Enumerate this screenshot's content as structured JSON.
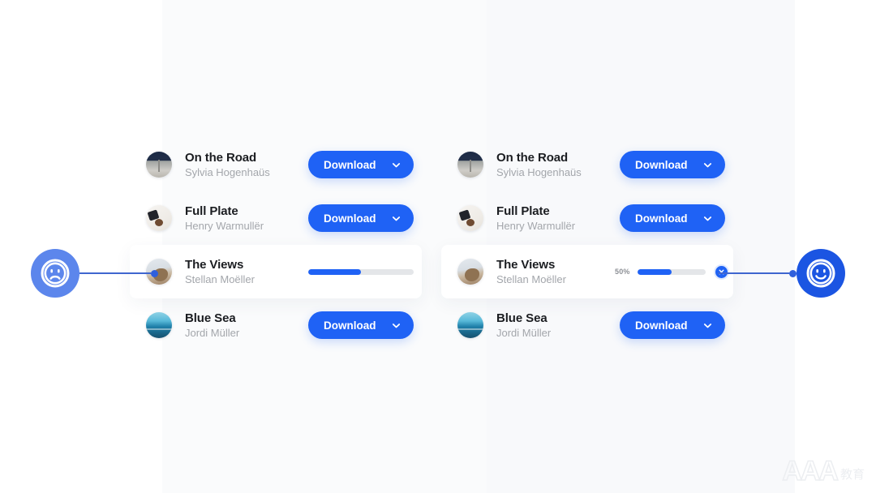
{
  "theme": {
    "accent": "#1f62f5",
    "accent_dark": "#1b55e2",
    "accent_soft": "#5c86ec",
    "page_bg": "#ffffff",
    "panel_bg": "#fafbfc",
    "card_bg": "#ffffff",
    "title_color": "#1b1d21",
    "subtitle_color": "#a3a6ab",
    "track_color": "#e4e6e9"
  },
  "variants": [
    {
      "id": "before",
      "state_icon": "sad-face-icon",
      "items": [
        {
          "title": "On the Road",
          "artist": "Sylvia Hogenhaüs",
          "avatar": "av-road",
          "action": "download",
          "button_label": "Download",
          "chevron": "chevron-down-icon"
        },
        {
          "title": "Full Plate",
          "artist": "Henry Warmullër",
          "avatar": "av-plate",
          "action": "download",
          "button_label": "Download",
          "chevron": "chevron-down-icon"
        },
        {
          "title": "The Views",
          "artist": "Stellan Moëller",
          "avatar": "av-views",
          "action": "progress",
          "progress_percent": 50,
          "percent_label": "",
          "show_percent": false,
          "show_cancel": false
        },
        {
          "title": "Blue Sea",
          "artist": "Jordi Müller",
          "avatar": "av-sea",
          "action": "download",
          "button_label": "Download",
          "chevron": "chevron-down-icon"
        }
      ]
    },
    {
      "id": "after",
      "state_icon": "happy-face-icon",
      "items": [
        {
          "title": "On the Road",
          "artist": "Sylvia Hogenhaüs",
          "avatar": "av-road",
          "action": "download",
          "button_label": "Download",
          "chevron": "chevron-down-icon"
        },
        {
          "title": "Full Plate",
          "artist": "Henry Warmullër",
          "avatar": "av-plate",
          "action": "download",
          "button_label": "Download",
          "chevron": "chevron-down-icon"
        },
        {
          "title": "The Views",
          "artist": "Stellan Moëller",
          "avatar": "av-views",
          "action": "progress",
          "progress_percent": 50,
          "percent_label": "50%",
          "show_percent": true,
          "show_cancel": true,
          "cancel_icon": "close-icon"
        },
        {
          "title": "Blue Sea",
          "artist": "Jordi Müller",
          "avatar": "av-sea",
          "action": "download",
          "button_label": "Download",
          "chevron": "chevron-down-icon"
        }
      ]
    }
  ],
  "watermark": {
    "latin": "AAA",
    "cjk": "教育"
  }
}
